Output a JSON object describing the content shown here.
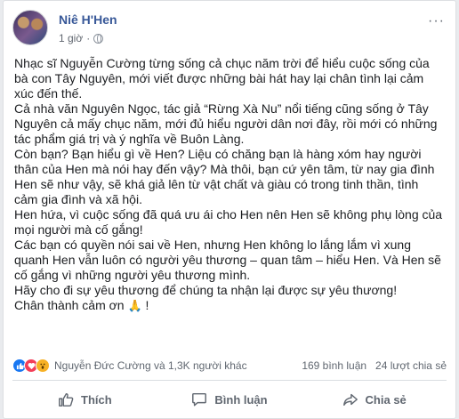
{
  "post": {
    "author": "Niê H'Hen",
    "time": "1 giờ",
    "time_separator": "·",
    "more_label": "···",
    "paragraphs": [
      "Nhạc sĩ Nguyễn Cường từng sống cả chục năm trời để hiểu cuộc sống của bà con Tây Nguyên, mới viết được những bài hát hay lại chân tình lại cảm xúc đến thế.",
      "Cả nhà văn Nguyên Ngọc, tác giả “Rừng Xà Nu” nổi tiếng cũng sống ở Tây Nguyên cả mấy chục năm, mới đủ hiểu người dân nơi đây, rồi mới có những tác phẩm giá trị và ý nghĩa về Buôn Làng.",
      "Còn bạn? Bạn hiểu gì về Hen? Liệu có chăng bạn là hàng xóm hay người thân của Hen mà nói hay đến vậy? Mà thôi, bạn cứ yên tâm, từ nay gia đình Hen sẽ như vậy, sẽ khá giả lên từ vật chất và giàu có trong tinh thần, tình cảm gia đình và xã hội.",
      "Hen hứa, vì cuộc sống đã quá ưu ái cho Hen nên Hen sẽ không phụ lòng của mọi người mà cố gắng!",
      "Các bạn có quyền nói sai về Hen, nhưng Hen không lo lắng lắm vì xung quanh Hen vẫn luôn có người yêu thương – quan tâm – hiểu Hen. Và Hen sẽ cố gắng vì những người yêu thương mình.",
      "Hãy cho đi sự yêu thương để chúng ta nhận lại được sự yêu thương!"
    ],
    "closing_text": "Chân thành cảm ơn",
    "closing_emoji": "🙏",
    "closing_end": " !"
  },
  "reactions": {
    "icons": [
      "like-icon",
      "love-icon",
      "wow-icon"
    ],
    "names": "Nguyễn Đức Cường và 1,3K người khác",
    "comments": "169 bình luận",
    "shares": "24 lượt chia sẻ"
  },
  "actions": {
    "like": "Thích",
    "comment": "Bình luận",
    "share": "Chia sẻ"
  },
  "colors": {
    "author": "#385898",
    "like": "#1877f2",
    "love": "#f33e58",
    "wow": "#f7b125"
  }
}
